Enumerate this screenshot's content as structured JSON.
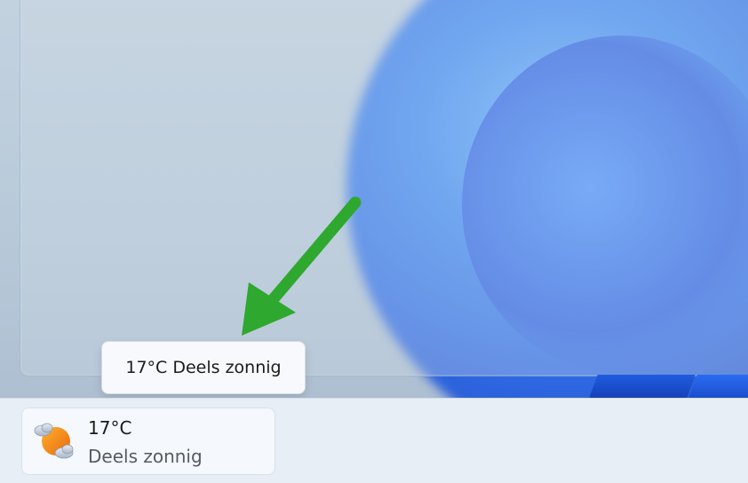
{
  "tooltip": {
    "text": "17°C Deels zonnig"
  },
  "weather_widget": {
    "temperature": "17°C",
    "condition": "Deels zonnig",
    "icon": "partly-sunny-icon"
  },
  "annotation": {
    "arrow_color": "#2ea82e"
  },
  "colors": {
    "wallpaper_blue": "#2f6de8",
    "taskbar_bg": "#e8eef6"
  }
}
